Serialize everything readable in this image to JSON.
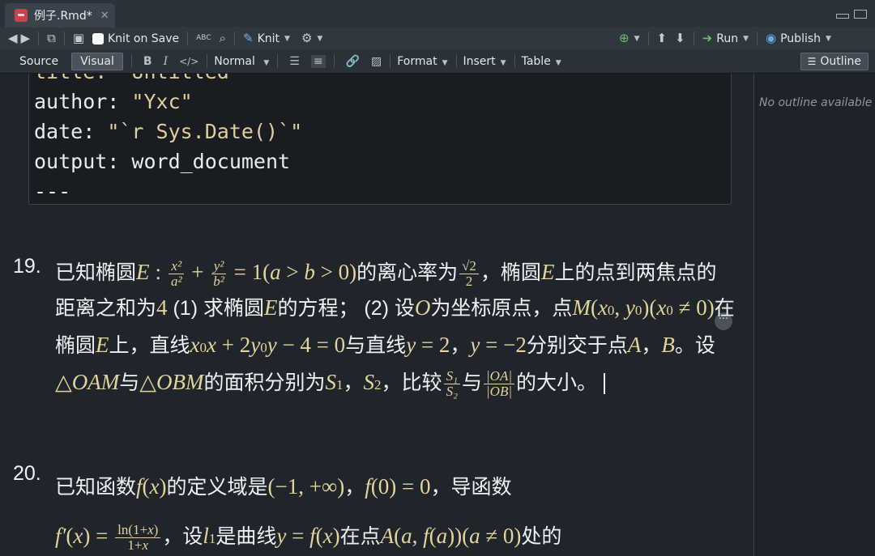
{
  "tab": {
    "title": "例子.Rmd*",
    "close": "✕"
  },
  "toolbar1": {
    "knit_on_save": "Knit on Save",
    "knit": "Knit",
    "run": "Run",
    "publish": "Publish"
  },
  "toolbar2": {
    "source": "Source",
    "visual": "Visual",
    "bold": "B",
    "italic": "I",
    "code": "</>",
    "style": "Normal",
    "format": "Format",
    "insert": "Insert",
    "table": "Table",
    "outline": "Outline"
  },
  "yaml": {
    "line0": "title: \"Untitled\"",
    "author_key": "author:",
    "author_val": "\"Yxc\"",
    "date_key": "date:",
    "date_val": "\"`r Sys.Date()`\"",
    "output_key": "output:",
    "output_val": "word_document",
    "end": "---"
  },
  "problem19": {
    "number": "19.",
    "t1": "已知椭圆",
    "t2": "的离心率为",
    "t3": "，椭圆",
    "t4": "上的点到两焦点的距离之和为",
    "t5": " (1) 求椭圆",
    "t6": "的方程； (2) 设",
    "t7": "为坐标原点，点",
    "t8": "在椭圆",
    "t9": "上，直线",
    "t10": "与直线",
    "t11": "，",
    "t12": "分别交于点",
    "t13": "，",
    "t14": "。设",
    "t15": "与",
    "t16": "的面积分别为",
    "t17": "，",
    "t18": "，比较",
    "t19": "与",
    "t20": "的大小。"
  },
  "problem20": {
    "number": "20.",
    "t1": "已知函数",
    "t2": "的定义域是",
    "t3": "，",
    "t4": "，导函数",
    "t5": "，设",
    "t6": "是曲线",
    "t7": "在点",
    "t8": "处的"
  },
  "outline_panel": {
    "empty": "No outline available"
  }
}
